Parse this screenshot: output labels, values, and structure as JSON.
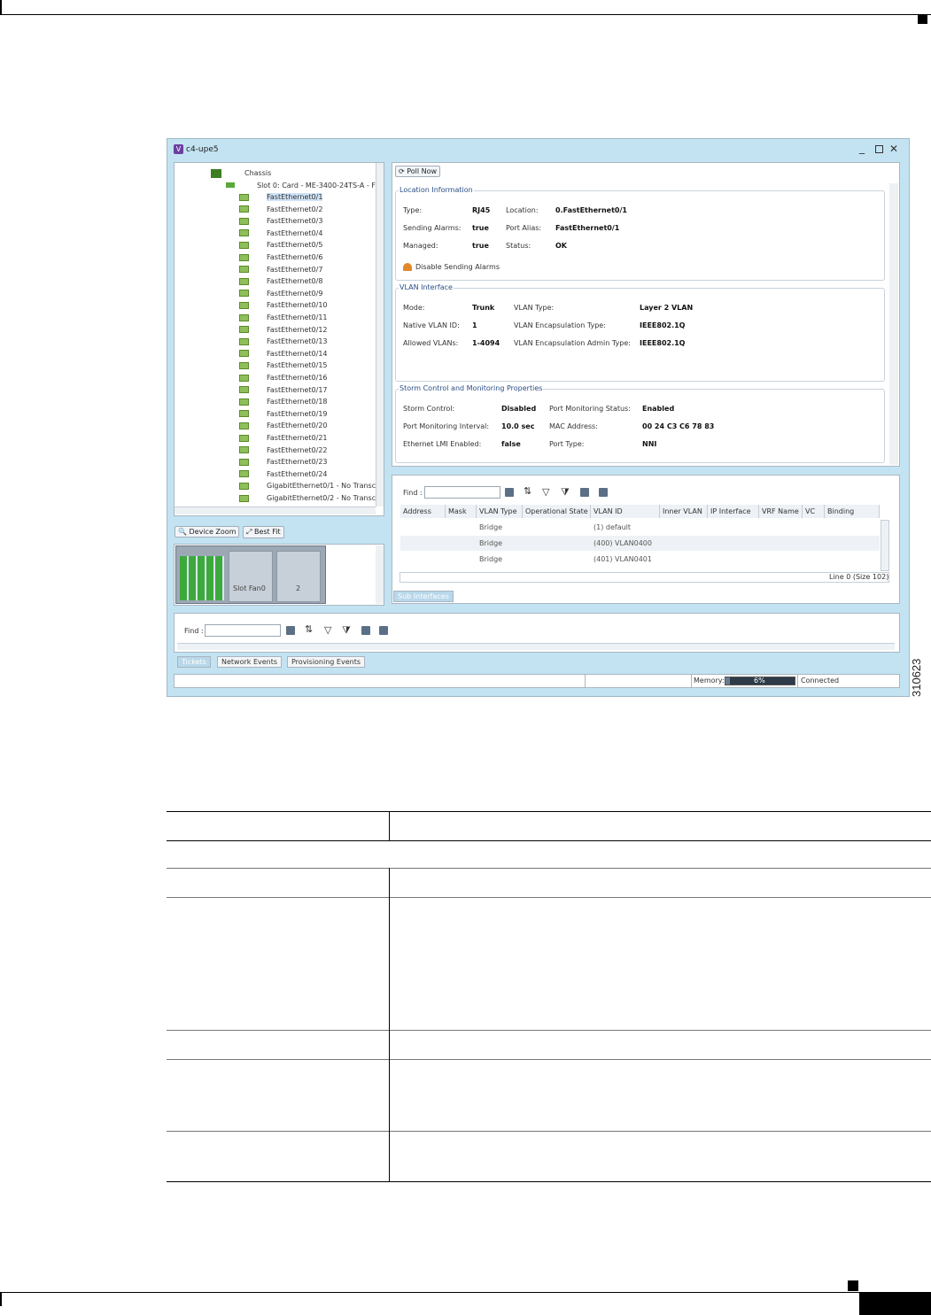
{
  "window": {
    "title": "c4-upe5",
    "min_icon": "minimize-icon",
    "max_icon": "maximize-icon",
    "close_icon": "close-icon"
  },
  "tree": {
    "items": [
      {
        "label": "Chassis"
      },
      {
        "label": "Slot 0: Card - ME-3400-24TS-A - F"
      },
      {
        "label": "FastEthernet0/1"
      },
      {
        "label": "FastEthernet0/2"
      },
      {
        "label": "FastEthernet0/3"
      },
      {
        "label": "FastEthernet0/4"
      },
      {
        "label": "FastEthernet0/5"
      },
      {
        "label": "FastEthernet0/6"
      },
      {
        "label": "FastEthernet0/7"
      },
      {
        "label": "FastEthernet0/8"
      },
      {
        "label": "FastEthernet0/9"
      },
      {
        "label": "FastEthernet0/10"
      },
      {
        "label": "FastEthernet0/11"
      },
      {
        "label": "FastEthernet0/12"
      },
      {
        "label": "FastEthernet0/13"
      },
      {
        "label": "FastEthernet0/14"
      },
      {
        "label": "FastEthernet0/15"
      },
      {
        "label": "FastEthernet0/16"
      },
      {
        "label": "FastEthernet0/17"
      },
      {
        "label": "FastEthernet0/18"
      },
      {
        "label": "FastEthernet0/19"
      },
      {
        "label": "FastEthernet0/20"
      },
      {
        "label": "FastEthernet0/21"
      },
      {
        "label": "FastEthernet0/22"
      },
      {
        "label": "FastEthernet0/23"
      },
      {
        "label": "FastEthernet0/24"
      },
      {
        "label": "GigabitEthernet0/1 - No Transc"
      },
      {
        "label": "GigabitEthernet0/2 - No Transc"
      }
    ]
  },
  "zoom": {
    "device_zoom": "Device Zoom",
    "best_fit": "Best Fit",
    "slot_label": "Slot Fan0",
    "slot_num": "2"
  },
  "toolbar": {
    "poll_now": "Poll Now"
  },
  "location": {
    "title": "Location Information",
    "type_label": "Type:",
    "type": "RJ45",
    "location_label": "Location:",
    "location": "0.FastEthernet0/1",
    "sending_label": "Sending Alarms:",
    "sending": "true",
    "alias_label": "Port Alias:",
    "alias": "FastEthernet0/1",
    "managed_label": "Managed:",
    "managed": "true",
    "status_label": "Status:",
    "status": "OK",
    "disable_link": "Disable Sending Alarms"
  },
  "vlan": {
    "title": "VLAN Interface",
    "mode_label": "Mode:",
    "mode": "Trunk",
    "vtype_label": "VLAN Type:",
    "vtype": "Layer 2 VLAN",
    "native_label": "Native VLAN ID:",
    "native": "1",
    "encap_label": "VLAN Encapsulation Type:",
    "encap": "IEEE802.1Q",
    "allowed_label": "Allowed VLANs:",
    "allowed": "1-4094",
    "encap_admin_label": "VLAN Encapsulation Admin Type:",
    "encap_admin": "IEEE802.1Q"
  },
  "storm": {
    "title": "Storm Control and Monitoring Properties",
    "storm_label": "Storm Control:",
    "storm": "Disabled",
    "pms_label": "Port Monitoring Status:",
    "pms": "Enabled",
    "pmi_label": "Port Monitoring Interval:",
    "pmi": "10.0 sec",
    "mac_label": "MAC Address:",
    "mac": "00 24 C3 C6 78 83",
    "lmi_label": "Ethernet LMI Enabled:",
    "lmi": "false",
    "ptype_label": "Port Type:",
    "ptype": "NNI"
  },
  "subtable": {
    "find_label": "Find :",
    "columns": [
      "Address",
      "Mask",
      "VLAN Type",
      "Operational State",
      "VLAN ID",
      "Inner VLAN",
      "IP Interface",
      "VRF Name",
      "VC",
      "Binding"
    ],
    "rows": [
      {
        "type": "Bridge",
        "vlan": "(1) default"
      },
      {
        "type": "Bridge",
        "vlan": "(400) VLAN0400"
      },
      {
        "type": "Bridge",
        "vlan": "(401) VLAN0401"
      }
    ],
    "status": "Line 0 (Size 102)",
    "tab": "Sub Interfaces"
  },
  "bottom": {
    "find_label": "Find :",
    "tabs": [
      "Tickets",
      "Network Events",
      "Provisioning Events"
    ],
    "memory_label": "Memory:",
    "memory_value": "6%",
    "memory_fraction": 0.06,
    "connected": "Connected"
  },
  "figure_id": "310623"
}
